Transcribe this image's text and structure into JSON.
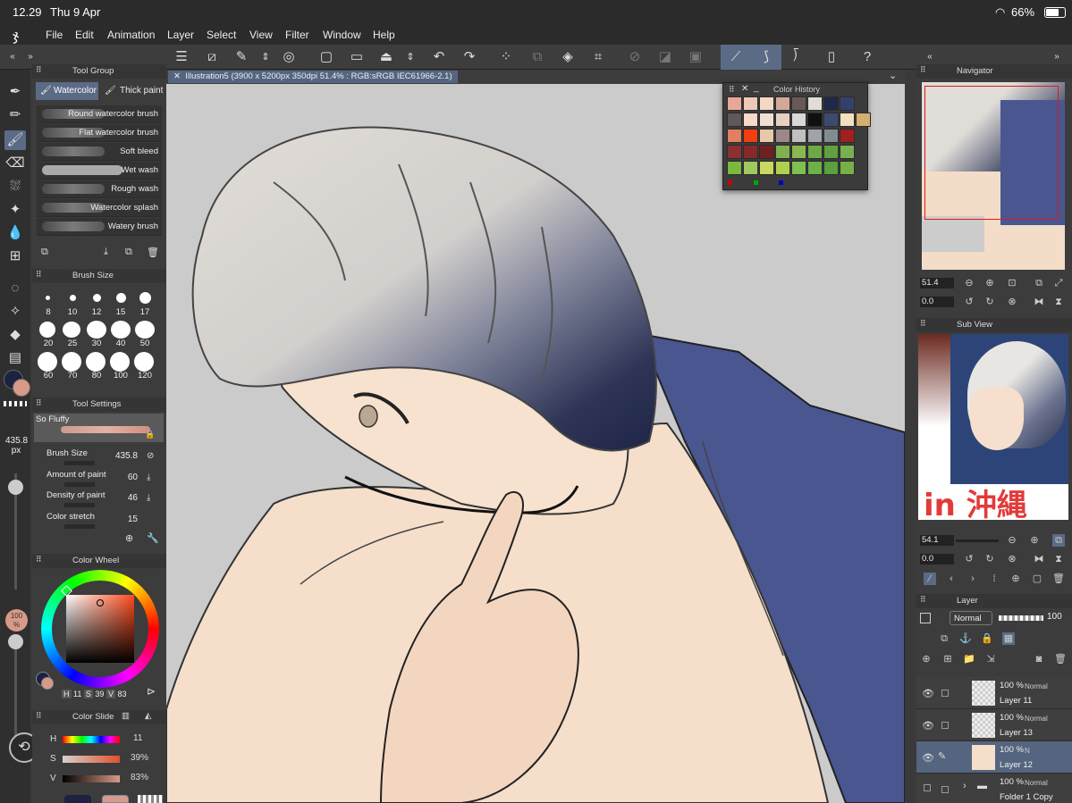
{
  "status": {
    "time": "12.29",
    "date": "Thu 9 Apr",
    "battery": "66%"
  },
  "menu": [
    "File",
    "Edit",
    "Animation",
    "Layer",
    "Select",
    "View",
    "Filter",
    "Window",
    "Help"
  ],
  "document": {
    "tab_title": "Illustration5 (3900 x 5200px 350dpi 51.4% : RGB:sRGB IEC61966-2.1)"
  },
  "tool_group": {
    "title": "Tool Group",
    "tabs": [
      "Watercolor",
      "Thick paint"
    ],
    "brushes": [
      "Round watercolor brush",
      "Flat watercolor brush",
      "Soft bleed",
      "Wet wash",
      "Rough wash",
      "Watercolor splash",
      "Watery brush"
    ]
  },
  "brush_size": {
    "title": "Brush Size",
    "sizes": [
      "8",
      "10",
      "12",
      "15",
      "17",
      "20",
      "25",
      "30",
      "40",
      "50",
      "60",
      "70",
      "80",
      "100",
      "120"
    ],
    "current": "435.8",
    "unit": "px"
  },
  "tool_settings": {
    "title": "Tool Settings",
    "preset": "So Fluffy",
    "rows": [
      {
        "label": "Brush Size",
        "value": "435.8"
      },
      {
        "label": "Amount of paint",
        "value": "60"
      },
      {
        "label": "Density of paint",
        "value": "46"
      },
      {
        "label": "Color stretch",
        "value": "15"
      }
    ]
  },
  "color_wheel": {
    "title": "Color Wheel",
    "h_label": "H",
    "h": "11",
    "s_label": "S",
    "s": "39",
    "v_label": "V",
    "v": "83"
  },
  "color_slider": {
    "title": "Color Slide",
    "rows": [
      {
        "label": "H",
        "value": "11"
      },
      {
        "label": "S",
        "value": "39%"
      },
      {
        "label": "V",
        "value": "83%"
      }
    ]
  },
  "opacity_left": "100\n%",
  "color_history": {
    "title": "Color History",
    "swatches": [
      "#e8a898",
      "#f0c8b8",
      "#f4d8c4",
      "#d4a898",
      "#6a5858",
      "#e0dcd8",
      "#1e2848",
      "#34406c",
      "#605858",
      "#f8d8c8",
      "#f0e0d4",
      "#e8d0c0",
      "#d8d8d8",
      "#101010",
      "#3c4a70",
      "#f4e0c0",
      "#d4b070",
      "#e08060",
      "#f04010",
      "#e8c8a8",
      "#9c8888",
      "#c0c0c0",
      "#a0a4a8",
      "#808c90",
      "#a02020",
      "#8a3030",
      "#882828",
      "#702020",
      "#82b050",
      "#8ab850",
      "#70a848",
      "#60a040",
      "#78b050",
      "#7ab840",
      "#a0c860",
      "#c8d860",
      "#b0d050",
      "#80c050",
      "#6cb048",
      "#58a040",
      "#78b048"
    ]
  },
  "navigator": {
    "title": "Navigator",
    "zoom": "51.4",
    "rotation": "0.0"
  },
  "subview": {
    "title": "Sub View",
    "zoom": "54.1",
    "rotation": "0.0",
    "caption": "in 沖縄"
  },
  "layer_panel": {
    "title": "Layer",
    "blend": "Normal",
    "opacity": "100",
    "layers": [
      {
        "pct": "100 %",
        "mode": "Normal",
        "name": "Layer 11",
        "selected": false
      },
      {
        "pct": "100 %",
        "mode": "Normal",
        "name": "Layer 13",
        "selected": false
      },
      {
        "pct": "100 %",
        "mode": "N",
        "name": "Layer 12",
        "selected": true
      },
      {
        "pct": "100 %",
        "mode": "Normal",
        "name": "Folder 1 Copy",
        "selected": false
      }
    ]
  },
  "colors": {
    "accent": "#5b6b86",
    "panel": "#3c3c3c",
    "main_color": "#1c2240",
    "sub_color": "#d89a88",
    "canvas_bg": "#cbcbcb"
  }
}
